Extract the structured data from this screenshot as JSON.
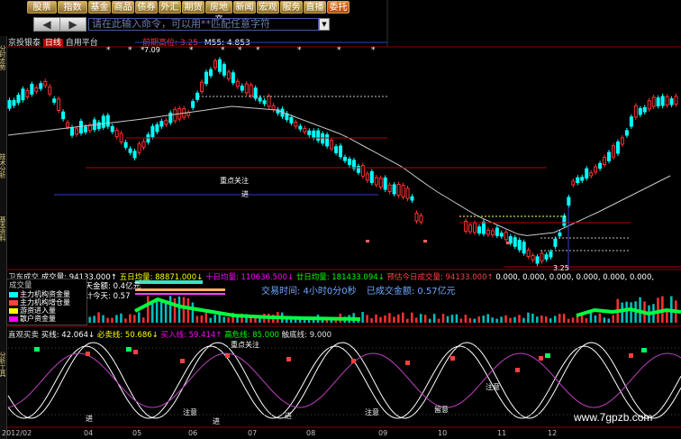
{
  "toolbar": {
    "buttons": [
      "股票",
      "指数",
      "基金",
      "商品",
      "债券",
      "外汇",
      "期货",
      "房地产",
      "新闻",
      "宏观",
      "服务",
      "直播",
      "委托"
    ],
    "active_index": 12,
    "back_label": "◀",
    "forward_label": "▶",
    "command_placeholder": "请在此输入命令，可以用**匹配任意字符",
    "dropdown_icon": "▼"
  },
  "sidebar": {
    "tabs": [
      "分时走势",
      "技术分析",
      "基本资料",
      "分析工具"
    ]
  },
  "main_chart": {
    "stock_name": "京投银泰",
    "tag_red": "日线",
    "tag_tool": "自用平台",
    "ma_label": "前期高位",
    "ma_value": ": 3.25",
    "ma55": "M55: 4.853",
    "top_price_label": "7.09",
    "low_price_label": "3.25",
    "annotation_focus": "重点关注",
    "annotation_enter": "进"
  },
  "volume_header": {
    "title": "卫东成交",
    "volume": "成交量: 94133.000↑",
    "ma5": "五日均量: 88871.000↓",
    "ma10": "十日均量: 110636.500↓",
    "ma20": "廿日均量: 181433.094↓",
    "predict": "预估今日成交量: 94133.000↑",
    "zeros": "0.000, 0.000, 0.000, 0.000, 0.000, 0.000,"
  },
  "volume_info": {
    "rise_label": "昨天金额: 0.4亿元",
    "predict_label": "预计今天: 0.57",
    "trade_time": "交易时间: 4小时0分0秒",
    "traded_amount": "已成交金额: 0.57亿元"
  },
  "legend": {
    "title": "成交量",
    "items": [
      {
        "label": "主力机构资金量",
        "color": "#00ffff"
      },
      {
        "label": "主力机构增仓量",
        "color": "#ff4040"
      },
      {
        "label": "游资进入量",
        "color": "#ffff00"
      },
      {
        "label": "散户资金量",
        "color": "#ff00ff"
      }
    ]
  },
  "osc_header": {
    "title": "直观买卖",
    "buy": "买线: 42.064↓",
    "must_sell": "必卖线: 50.686↓",
    "buy_in": "买入线: 59.414↑",
    "high_risk": "高危线: 85.000",
    "bottom": "触底线: 9.000"
  },
  "osc_annotations": {
    "focus": "重点关注",
    "enter": "进",
    "attention": "注意",
    "watch": "留意"
  },
  "x_axis": [
    "2012/02",
    "04",
    "05",
    "06",
    "07",
    "08",
    "09",
    "10",
    "11",
    "12"
  ],
  "watermark": "www.7gpzb.com",
  "chart_data": {
    "type": "candlestick",
    "title": "",
    "xlabel": "",
    "ylabel": "",
    "grid": false,
    "price_markers": [
      "7.09",
      "3.25"
    ],
    "colors": {
      "up": "#ff3030",
      "down": "#00ffff",
      "ma": "#c8c8c8",
      "level": "#b00000"
    }
  }
}
